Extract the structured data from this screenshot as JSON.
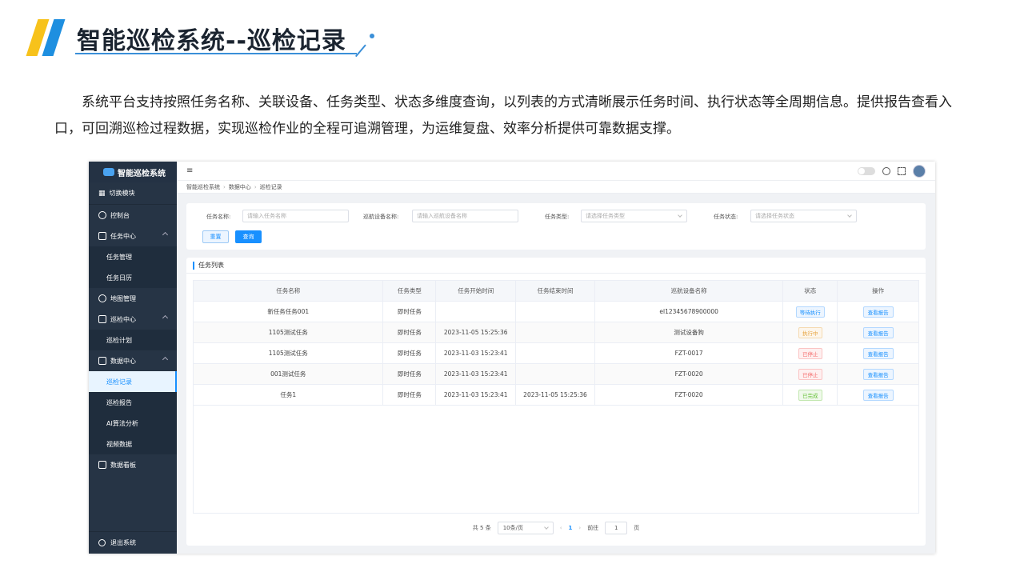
{
  "slide": {
    "title": "智能巡检系统--巡检记录",
    "description": "系统平台支持按照任务名称、关联设备、任务类型、状态多维度查询，以列表的方式清晰展示任务时间、执行状态等全周期信息。提供报告查看入口，可回溯巡检过程数据，实现巡检作业的全程可追溯管理，为运维复盘、效率分析提供可靠数据支撑。"
  },
  "colors": {
    "accent": "#1890ff",
    "sidebar": "#263445",
    "stripe_yellow": "#f7c21b",
    "stripe_blue": "#1e8fe0"
  },
  "sidebar": {
    "logo": "智能巡检系统",
    "switch_module": "切换模块",
    "items": [
      {
        "label": "控制台",
        "icon": "dashboard-icon"
      },
      {
        "label": "任务中心",
        "icon": "task-icon",
        "children": [
          "任务管理",
          "任务日历"
        ]
      },
      {
        "label": "地图管理",
        "icon": "map-icon"
      },
      {
        "label": "巡检中心",
        "icon": "inspection-icon",
        "children": [
          "巡检计划"
        ]
      },
      {
        "label": "数据中心",
        "icon": "data-icon",
        "children": [
          "巡检记录",
          "巡检报告",
          "AI算法分析",
          "视频数据"
        ]
      },
      {
        "label": "数据看板",
        "icon": "board-icon"
      }
    ],
    "active": "巡检记录",
    "logout": "退出系统"
  },
  "topbar": {
    "menu_glyph": "≡"
  },
  "breadcrumb": [
    "智能巡检系统",
    "数据中心",
    "巡检记录"
  ],
  "search": {
    "task_name_label": "任务名称:",
    "task_name_placeholder": "请输入任务名称",
    "device_label": "巡航设备名称:",
    "device_placeholder": "请输入巡航设备名称",
    "type_label": "任务类型:",
    "type_placeholder": "请选择任务类型",
    "status_label": "任务状态:",
    "status_placeholder": "请选择任务状态",
    "reset": "重置",
    "query": "查询"
  },
  "list": {
    "title": "任务列表",
    "columns": [
      "任务名称",
      "任务类型",
      "任务开始时间",
      "任务结束时间",
      "巡航设备名称",
      "状态",
      "操作"
    ],
    "rows": [
      {
        "name": "新任务任务001",
        "type": "即时任务",
        "start": "",
        "end": "",
        "device": "el12345678900000",
        "status": "等待执行",
        "status_kind": "wait",
        "action": "查看报告"
      },
      {
        "name": "1105测试任务",
        "type": "即时任务",
        "start": "2023-11-05 15:25:36",
        "end": "",
        "device": "测试设备狗",
        "status": "执行中",
        "status_kind": "run",
        "action": "查看报告"
      },
      {
        "name": "1105测试任务",
        "type": "即时任务",
        "start": "2023-11-03 15:23:41",
        "end": "",
        "device": "FZT-0017",
        "status": "已停止",
        "status_kind": "stop",
        "action": "查看报告"
      },
      {
        "name": "001测试任务",
        "type": "即时任务",
        "start": "2023-11-03 15:23:41",
        "end": "",
        "device": "FZT-0020",
        "status": "已停止",
        "status_kind": "stop",
        "action": "查看报告"
      },
      {
        "name": "任务1",
        "type": "即时任务",
        "start": "2023-11-03 15:23:41",
        "end": "2023-11-05 15:25:36",
        "device": "FZT-0020",
        "status": "已完成",
        "status_kind": "done",
        "action": "查看报告"
      }
    ]
  },
  "pager": {
    "total": "共 5 条",
    "page_size": "10条/页",
    "prev": "‹",
    "current": "1",
    "next": "›",
    "goto_label": "前往",
    "goto_value": "1",
    "page_unit": "页"
  }
}
